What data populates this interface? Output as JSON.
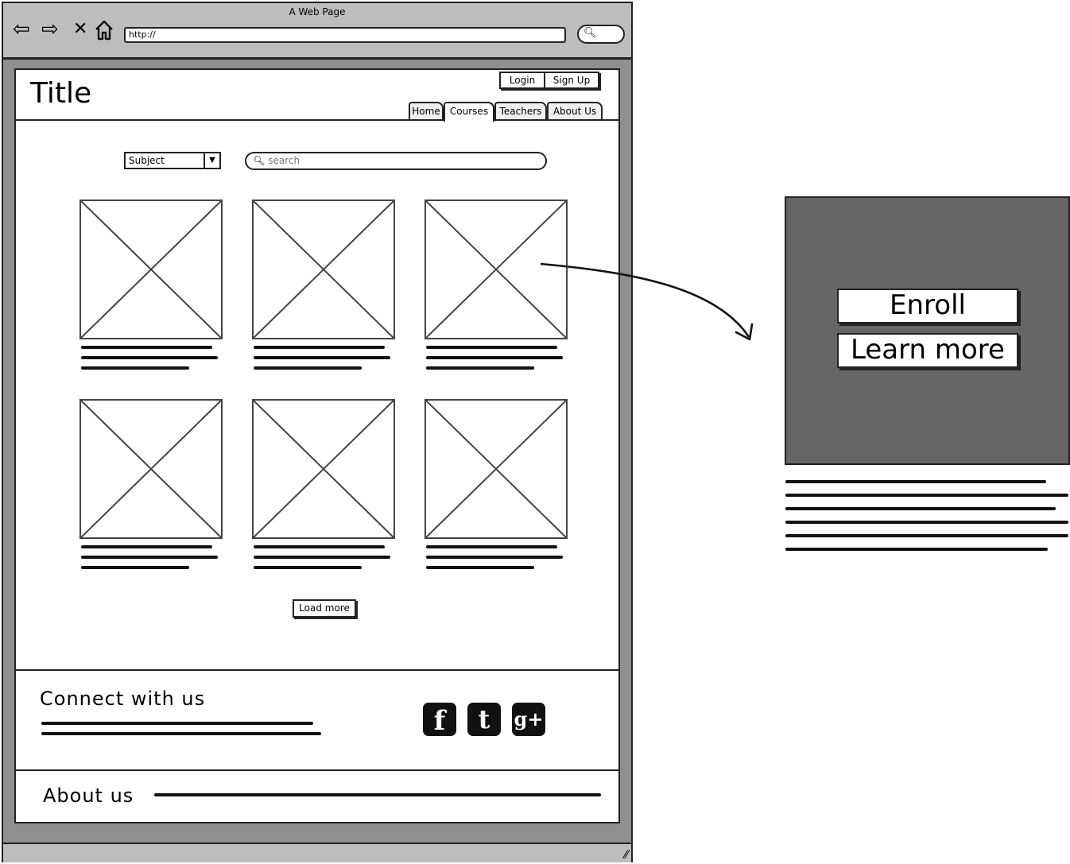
{
  "browser": {
    "window_title": "A Web Page",
    "url": "http://",
    "icons": [
      "back-icon",
      "forward-icon",
      "close-icon",
      "home-icon",
      "search-icon",
      "resize-grip-icon"
    ]
  },
  "header": {
    "title": "Title",
    "login_label": "Login",
    "signup_label": "Sign Up",
    "tabs": [
      {
        "label": "Home"
      },
      {
        "label": "Courses",
        "active": true
      },
      {
        "label": "Teachers"
      },
      {
        "label": "About Us"
      }
    ]
  },
  "filters": {
    "subject_value": "Subject",
    "search_placeholder": "search"
  },
  "grid": {
    "cards": [
      {
        "image": "image-placeholder"
      },
      {
        "image": "image-placeholder"
      },
      {
        "image": "image-placeholder"
      },
      {
        "image": "image-placeholder"
      },
      {
        "image": "image-placeholder"
      },
      {
        "image": "image-placeholder"
      }
    ],
    "load_more_label": "Load more"
  },
  "footer": {
    "connect_heading": "Connect with us",
    "social_icons": [
      "facebook-icon",
      "twitter-icon",
      "google-plus-icon"
    ],
    "facebook_glyph": "f",
    "twitter_glyph": "t",
    "google_glyph": "g+",
    "about_heading": "About us"
  },
  "overlay": {
    "enroll_label": "Enroll",
    "learn_more_label": "Learn more"
  },
  "colors": {
    "browser_chrome": "#bdbdbd",
    "content_background": "#8f8f8f",
    "overlay_panel": "#666666",
    "ink": "#222222"
  }
}
